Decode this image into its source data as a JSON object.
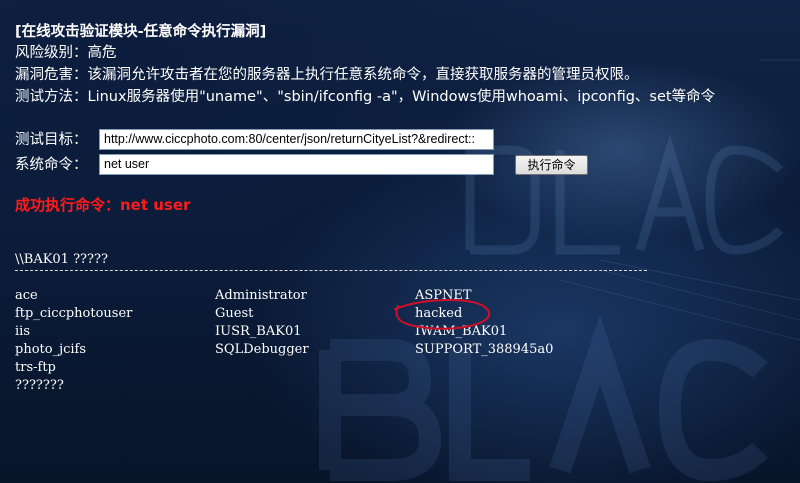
{
  "header": {
    "title": "[在线攻击验证模块-任意命令执行漏洞]",
    "risk_level": "风险级别：高危",
    "harm": "漏洞危害：该漏洞允许攻击者在您的服务器上执行任意系统命令，直接获取服务器的管理员权限。",
    "method": "测试方法：Linux服务器使用\"uname\"、\"sbin/ifconfig -a\"，Windows使用whoami、ipconfig、set等命令"
  },
  "form": {
    "target_label": "测试目标：",
    "target_value": "http://www.ciccphoto.com:80/center/json/returnCityeList?&redirect::",
    "command_label": "系统命令：",
    "command_value": "net user",
    "execute_label": "执行命令"
  },
  "result": {
    "status": "成功执行命令：net user",
    "server_line": "\\\\BAK01 ?????",
    "columns": [
      [
        "ace",
        "ftp_ciccphotouser",
        "iis",
        "photo_jcifs",
        "trs-ftp",
        "???????"
      ],
      [
        "Administrator",
        "Guest",
        "IUSR_BAK01",
        "SQLDebugger"
      ],
      [
        "ASPNET",
        "hacked",
        "IWAM_BAK01",
        "SUPPORT_388945a0"
      ]
    ]
  },
  "colors": {
    "success": "#ff1a1a",
    "annotation": "#d0102a"
  }
}
